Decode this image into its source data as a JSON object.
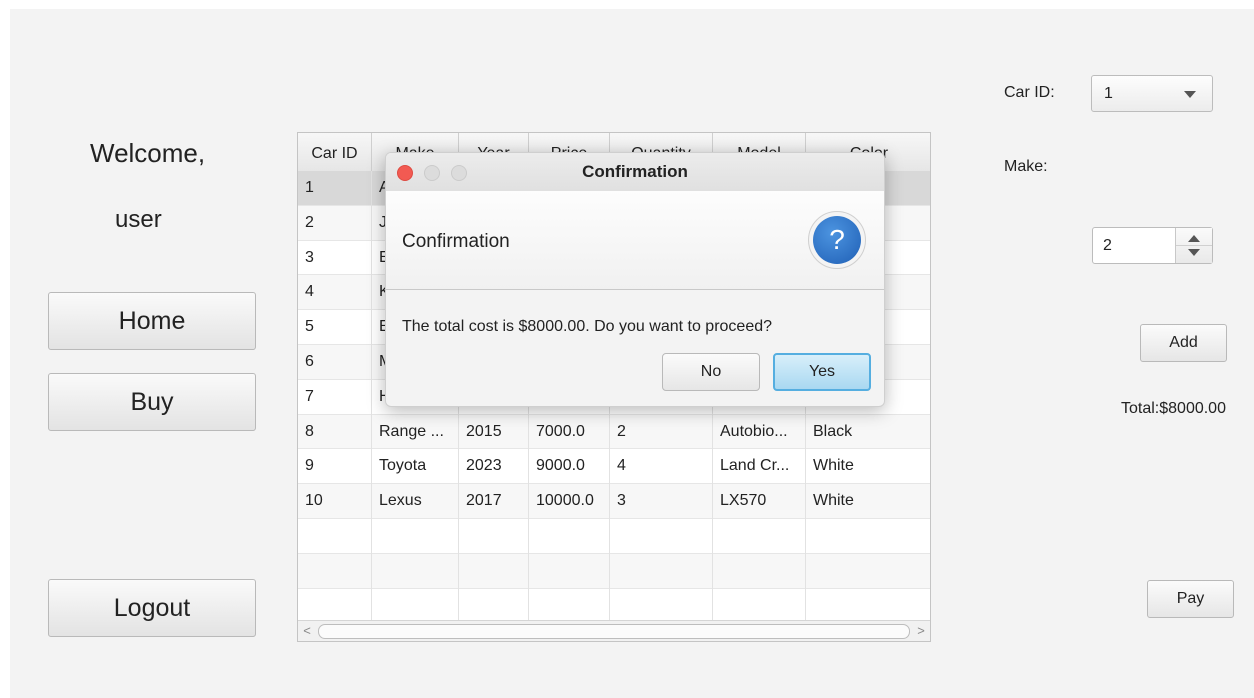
{
  "sidebar": {
    "welcome": "Welcome,",
    "username": "user",
    "home_label": "Home",
    "buy_label": "Buy",
    "logout_label": "Logout"
  },
  "table": {
    "columns": [
      "Car ID",
      "Make",
      "Year",
      "Price",
      "Quantity",
      "Model",
      "Color"
    ],
    "rows": [
      [
        "1",
        "A",
        "",
        "",
        "",
        "",
        ""
      ],
      [
        "2",
        "J",
        "",
        "",
        "",
        "",
        ""
      ],
      [
        "3",
        "E",
        "",
        "",
        "",
        "",
        ""
      ],
      [
        "4",
        "K",
        "",
        "",
        "",
        "",
        ""
      ],
      [
        "5",
        "E",
        "",
        "",
        "",
        "",
        ""
      ],
      [
        "6",
        "M",
        "",
        "",
        "",
        "",
        ""
      ],
      [
        "7",
        "H",
        "",
        "",
        "",
        "",
        ""
      ],
      [
        "8",
        "Range ...",
        "2015",
        "7000.0",
        "2",
        "Autobio...",
        "Black"
      ],
      [
        "9",
        "Toyota",
        "2023",
        "9000.0",
        "4",
        "Land Cr...",
        "White"
      ],
      [
        "10",
        "Lexus",
        "2017",
        "10000.0",
        "3",
        "LX570",
        "White"
      ]
    ],
    "scroll_left_glyph": "<",
    "scroll_right_glyph": ">"
  },
  "form": {
    "car_id_label": "Car ID:",
    "car_id_value": "1",
    "make_label": "Make:",
    "quantity_value": "2",
    "add_label": "Add",
    "total_text": "Total:$8000.00",
    "pay_label": "Pay"
  },
  "dialog": {
    "title": "Confirmation",
    "header": "Confirmation",
    "icon_glyph": "?",
    "message": "The total cost is $8000.00. Do you want to proceed?",
    "no_label": "No",
    "yes_label": "Yes"
  },
  "colors": {
    "accent_yes": "#55aee0",
    "close_dot": "#f25a52",
    "question_icon": "#1f5fb5"
  }
}
